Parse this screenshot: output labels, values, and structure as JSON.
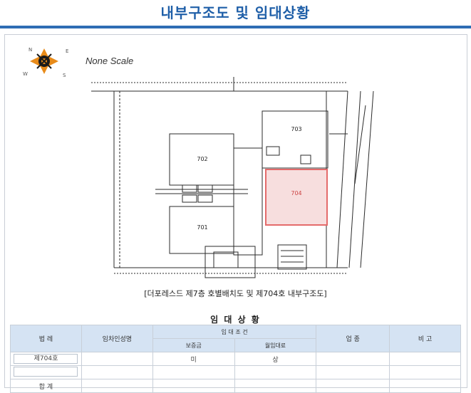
{
  "header": {
    "title": "내부구조도 및 임대상황"
  },
  "plan": {
    "scale_label": "None Scale",
    "compass_letters": [
      "N",
      "E",
      "S",
      "W"
    ],
    "room_labels": [
      "703",
      "702",
      "704",
      "701"
    ],
    "caption": "[더포레스드 제7층 호별배치도 및 제704호 내부구조도]"
  },
  "lease": {
    "title": "임 대 상 황",
    "headers": {
      "unit": "법 레",
      "tenant": "임차인성명",
      "terms": "임 대 조 건",
      "deposit": "보증금",
      "rent": "월임대료",
      "business": "업 종",
      "note": "비 고"
    },
    "rows": [
      {
        "unit": "제704호",
        "tenant": "",
        "deposit": "미",
        "rent": "상",
        "business": "",
        "note": ""
      },
      {
        "unit": "",
        "tenant": "",
        "deposit": "",
        "rent": "",
        "business": "",
        "note": ""
      }
    ],
    "total_label": "합 계"
  },
  "colors": {
    "title": "#1f5fa8",
    "rule": "#2e6db4",
    "header_bg": "#d5e3f3",
    "highlight": "#e46b6b"
  }
}
